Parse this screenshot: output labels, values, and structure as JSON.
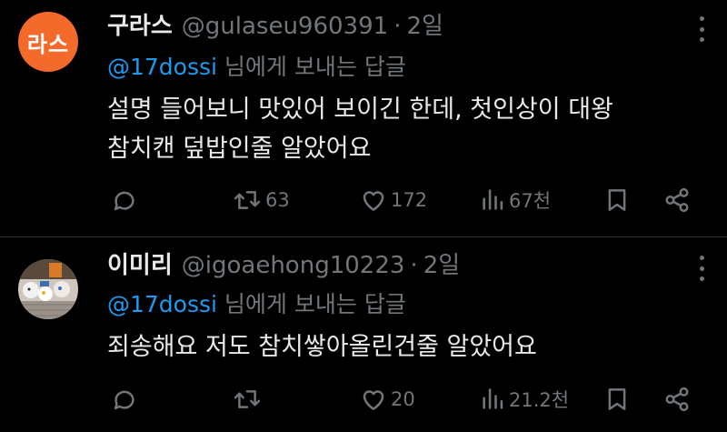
{
  "tweets": [
    {
      "avatar_text": "라스",
      "avatar_color": "#f36a2a",
      "name": "구라스",
      "handle": "@gulaseu960391",
      "separator": "·",
      "time": "2일",
      "reply_to_mention": "@17dossi",
      "reply_to_suffix": " 님에게 보내는 답글",
      "body_lines": [
        "설명 들어보니 맛있어 보이긴 한데, 첫인상이 대왕",
        "참치캔 덮밥인줄 알았어요"
      ],
      "retweets": "63",
      "likes": "172",
      "views": "67천"
    },
    {
      "name": "이미리",
      "handle": "@igoaehong10223",
      "separator": "·",
      "time": "2일",
      "reply_to_mention": "@17dossi",
      "reply_to_suffix": " 님에게 보내는 답글",
      "body_lines": [
        "죄송해요 저도 참치쌓아올린건줄 알았어요"
      ],
      "retweets": "",
      "likes": "20",
      "views": "21.2천"
    }
  ],
  "colors": {
    "mention": "#1d9bf0",
    "muted": "#71767b",
    "text": "#e7e9ea",
    "background": "#000000"
  },
  "icons": [
    "reply-icon",
    "retweet-icon",
    "like-icon",
    "views-icon",
    "bookmark-icon",
    "share-icon",
    "more-icon"
  ]
}
